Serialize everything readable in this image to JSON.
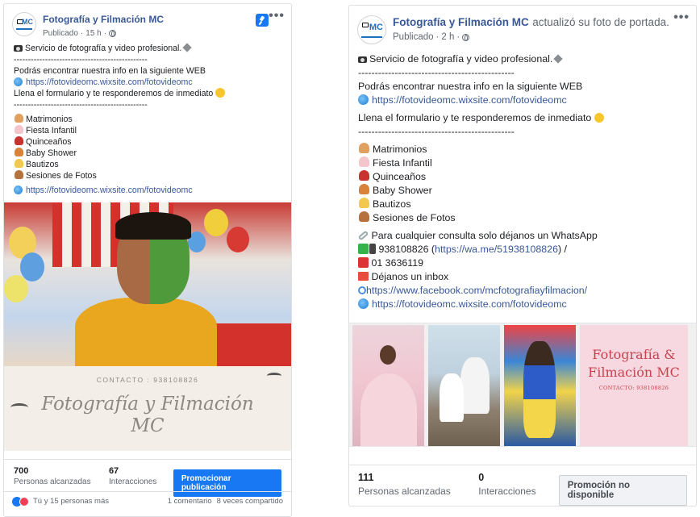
{
  "colors": {
    "link": "#385898",
    "primary": "#1877f2",
    "muted": "#606770"
  },
  "post1": {
    "page_name": "Fotografía y Filmación MC",
    "status": "Publicado",
    "time": "15 h",
    "icons": [
      "pin-icon",
      "more-options-icon",
      "globe-icon"
    ],
    "lines": {
      "service": "Servicio de fotografía y video profesional.",
      "divider": "-----------------------------------------------",
      "info": "Podrás encontrar nuestra info en la siguiente WEB",
      "web": "https://fotovideomc.wixsite.com/fotovideomc",
      "form": "Llena el formulario y te responderemos de inmediato",
      "events": [
        "Matrimonios",
        "Fiesta Infantil",
        "Quinceaños",
        "Baby Shower",
        "Bautizos",
        "Sesiones de Fotos"
      ],
      "web2": "https://fotovideomc.wixsite.com/fotovideomc"
    },
    "image": {
      "contact": "CONTACTO : 938108826",
      "script_line1": "Fotografía y Filmación",
      "script_line2": "MC"
    },
    "stats": {
      "reach_value": "700",
      "reach_label": "Personas alcanzadas",
      "interactions_value": "67",
      "interactions_label": "Interacciones",
      "promote_label": "Promocionar publicación"
    },
    "reactions": {
      "who": "Tú y 15 personas más",
      "comments": "1 comentario",
      "shares": "8 veces compartido"
    }
  },
  "post2": {
    "page_name": "Fotografía y Filmación MC",
    "action": "actualizó su foto de portada.",
    "status": "Publicado",
    "time": "2 h",
    "lines": {
      "service": "Servicio de fotografía y video profesional.",
      "divider": "-----------------------------------------------",
      "info": "Podrás encontrar nuestra info en la siguiente WEB",
      "web": "https://fotovideomc.wixsite.com/fotovideomc",
      "form": "Llena el formulario y te responderemos de inmediato",
      "divider2": "-----------------------------------------------",
      "events": [
        "Matrimonios",
        "Fiesta Infantil",
        "Quinceaños",
        "Baby Shower",
        "Bautizos",
        "Sesiones de Fotos"
      ],
      "consult": "Para cualquier consulta solo déjanos un WhatsApp",
      "phone": "938108826 (",
      "wa_link": "https://wa.me/51938108826",
      "phone_end": ") /",
      "landline": "01 3636119",
      "inbox": "Déjanos un inbox",
      "fb_link": "https://www.facebook.com/mcfotografiayfilmacion/",
      "web2": "https://fotovideomc.wixsite.com/fotovideomc"
    },
    "cover": {
      "title": "Fotografía & Filmación MC",
      "contact": "CONTACTO: 938108826"
    },
    "stats": {
      "reach_value": "111",
      "reach_label": "Personas alcanzadas",
      "interactions_value": "0",
      "interactions_label": "Interacciones",
      "promo_label": "Promoción no disponible"
    }
  }
}
